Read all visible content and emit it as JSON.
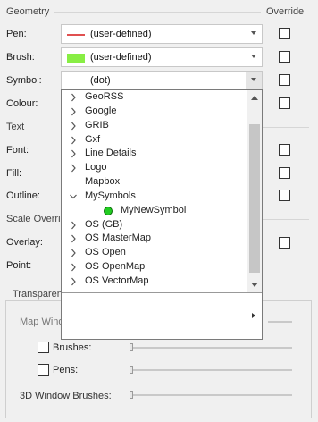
{
  "geometry": {
    "header": "Geometry",
    "override_header": "Override",
    "pen_label": "Pen:",
    "pen_value": "(user-defined)",
    "pen_color": "#e05050",
    "brush_label": "Brush:",
    "brush_value": "(user-defined)",
    "brush_color": "#88ee44",
    "symbol_label": "Symbol:",
    "symbol_value": "(dot)",
    "colour_label": "Colour:"
  },
  "text_section": {
    "header": "Text",
    "font_label": "Font:",
    "fill_label": "Fill:",
    "outline_label": "Outline:"
  },
  "scale": {
    "header": "Scale Overrid",
    "overlay_label": "Overlay:",
    "point_label": "Point:"
  },
  "dropdown": {
    "items": [
      {
        "label": "GeoRSS",
        "state": "collapsed"
      },
      {
        "label": "Google",
        "state": "collapsed"
      },
      {
        "label": "GRIB",
        "state": "collapsed"
      },
      {
        "label": "Gxf",
        "state": "collapsed"
      },
      {
        "label": "Line Details",
        "state": "collapsed"
      },
      {
        "label": "Logo",
        "state": "collapsed"
      },
      {
        "label": "Mapbox",
        "state": "none"
      },
      {
        "label": "MySymbols",
        "state": "expanded"
      },
      {
        "label": "MyNewSymbol",
        "state": "child"
      },
      {
        "label": "OS (GB)",
        "state": "collapsed"
      },
      {
        "label": "OS MasterMap",
        "state": "collapsed"
      },
      {
        "label": "OS Open",
        "state": "collapsed"
      },
      {
        "label": "OS OpenMap",
        "state": "collapsed"
      },
      {
        "label": "OS VectorMap",
        "state": "collapsed"
      }
    ],
    "child_symbol_color": "#22cc22"
  },
  "transparency": {
    "header": "Transparen",
    "map_window_label": "Map Windo",
    "brushes_label": "Brushes:",
    "pens_label": "Pens:",
    "window3d_label": "3D Window Brushes:"
  }
}
